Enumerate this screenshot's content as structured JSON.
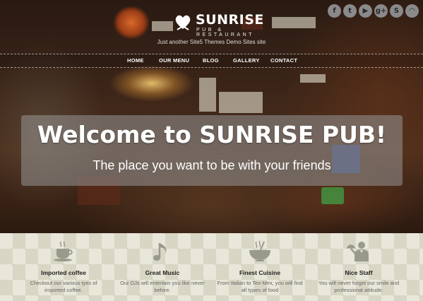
{
  "header": {
    "brand": "SUNRISE",
    "brand_sub": "PUB & RESTAURANT",
    "tagline": "Just another Site5 Themes Demo Sites site"
  },
  "social": [
    {
      "name": "facebook-icon",
      "glyph": "f"
    },
    {
      "name": "twitter-icon",
      "glyph": "t"
    },
    {
      "name": "youtube-icon",
      "glyph": "▶"
    },
    {
      "name": "google-plus-icon",
      "glyph": "g+"
    },
    {
      "name": "skype-icon",
      "glyph": "S"
    },
    {
      "name": "rss-icon",
      "glyph": "◠"
    }
  ],
  "nav": {
    "items": [
      {
        "label": "HOME"
      },
      {
        "label": "OUR MENU"
      },
      {
        "label": "BLOG"
      },
      {
        "label": "GALLERY"
      },
      {
        "label": "CONTACT"
      }
    ]
  },
  "hero": {
    "title": "Welcome to SUNRISE PUB!",
    "subtitle": "The place you want to be with your friends"
  },
  "features": [
    {
      "title": "Imported coffee",
      "text": "Checkout our various tyes of imported coffee.",
      "icon": "coffee-cup-icon"
    },
    {
      "title": "Great Music",
      "text": "Our DJs will entertain you like never before.",
      "icon": "music-note-icon"
    },
    {
      "title": "Finest Cuisine",
      "text": "From Italian to Tex-Mex, you will find all types of food",
      "icon": "soup-bowl-icon"
    },
    {
      "title": "Nice Staff",
      "text": "You will never forget our smile and professional attitude.",
      "icon": "waiter-icon"
    }
  ],
  "colors": {
    "nav_text": "#ffffff",
    "feature_bg": "#e9e7d9",
    "icon_color": "#9a9a8c",
    "social_icon_bg": "#8a8a8a"
  }
}
